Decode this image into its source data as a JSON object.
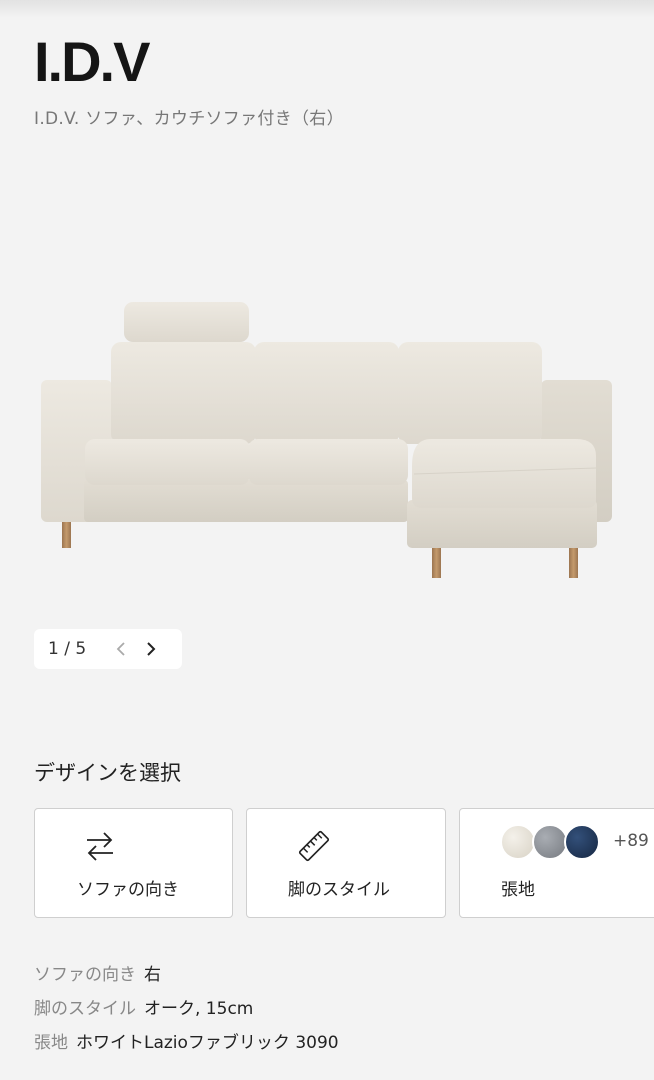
{
  "header": {
    "brand": "I.D.V",
    "subtitle": "I.D.V. ソファ、カウチソファ付き（右）"
  },
  "gallery": {
    "current": "1",
    "separator": "/",
    "total": "5",
    "count_text": "1 / 5"
  },
  "design": {
    "title": "デザインを選択",
    "options": [
      {
        "label": "ソファの向き",
        "icon": "swap-arrows-icon"
      },
      {
        "label": "脚のスタイル",
        "icon": "ruler-icon"
      },
      {
        "label": "張地",
        "more": "+89",
        "swatches": [
          "#e6e2d8",
          "#8c9096",
          "#1f3554"
        ]
      }
    ]
  },
  "specs": [
    {
      "key": "ソファの向き",
      "value": "右"
    },
    {
      "key": "脚のスタイル",
      "value": "オーク, 15cm"
    },
    {
      "key": "張地",
      "value": "ホワイトLazioファブリック 3090"
    }
  ],
  "colors": {
    "background": "#f3f3f3",
    "sofa_fabric": "#e8e4dc",
    "leg_wood": "#b48a5f"
  }
}
